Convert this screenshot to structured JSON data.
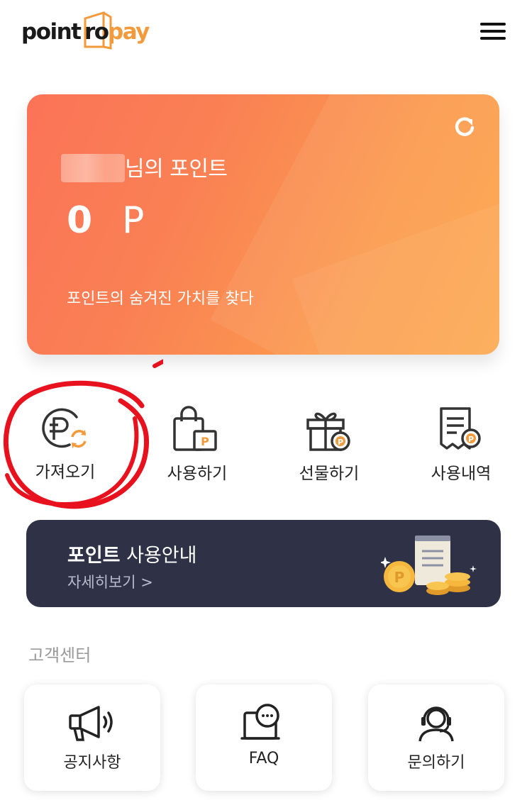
{
  "header": {
    "logo": {
      "part1": "point",
      "part2": "ro",
      "part3": "pay"
    },
    "menu_icon": "hamburger-menu-icon",
    "brand_color": "#f39a3c"
  },
  "point_card": {
    "user_name_masked": "",
    "title_suffix": "님의 포인트",
    "amount": "0",
    "unit": "P",
    "slogan": "포인트의 숨겨진 가치를 찾다",
    "refresh_icon": "refresh-icon",
    "gradient_colors": [
      "#fb7357",
      "#fca548"
    ]
  },
  "actions": [
    {
      "label": "가져오기",
      "icon": "point-exchange-icon"
    },
    {
      "label": "사용하기",
      "icon": "shopping-bag-point-icon"
    },
    {
      "label": "선물하기",
      "icon": "gift-point-icon"
    },
    {
      "label": "사용내역",
      "icon": "receipt-point-icon"
    }
  ],
  "guide_banner": {
    "title_bold": "포인트",
    "title_rest": " 사용안내",
    "link": "자세히보기 >",
    "bg_color": "#2f3146"
  },
  "customer_center": {
    "title": "고객센터",
    "items": [
      {
        "label": "공지사항",
        "icon": "megaphone-icon"
      },
      {
        "label": "FAQ",
        "icon": "faq-chat-icon"
      },
      {
        "label": "문의하기",
        "icon": "headset-agent-icon"
      }
    ]
  },
  "annotation_color": "#e8121f"
}
